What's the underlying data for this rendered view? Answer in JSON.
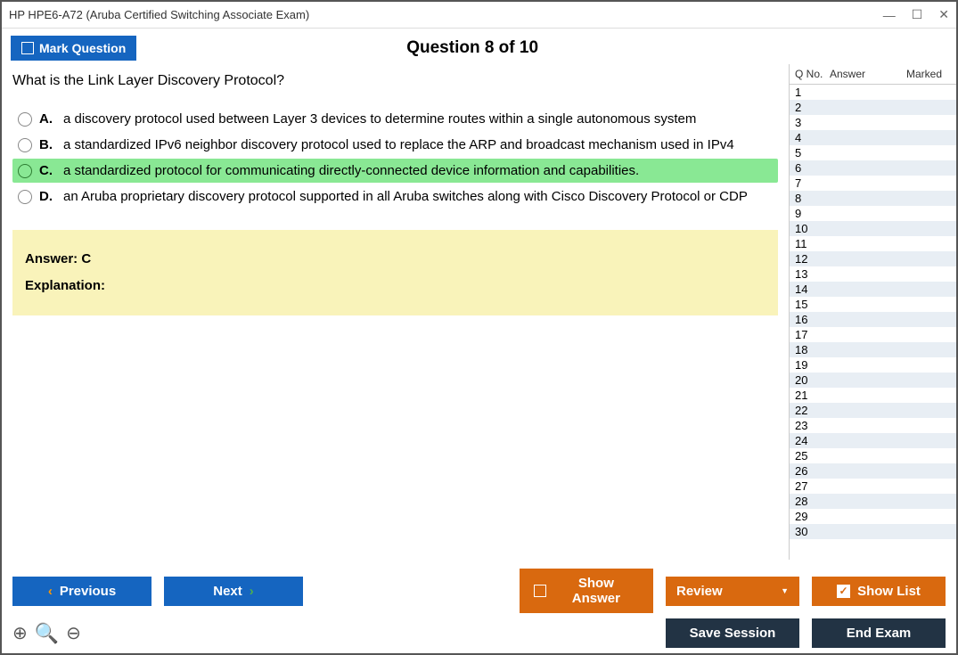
{
  "window": {
    "title": "HP HPE6-A72 (Aruba Certified Switching Associate Exam)"
  },
  "header": {
    "mark_label": "Mark Question",
    "question_counter": "Question 8 of 10"
  },
  "question": {
    "text": "What is the Link Layer Discovery Protocol?",
    "options": [
      {
        "letter": "A.",
        "text": "a discovery protocol used between Layer 3 devices to determine routes within a single autonomous system",
        "correct": false
      },
      {
        "letter": "B.",
        "text": "a standardized IPv6 neighbor discovery protocol used to replace the ARP and broadcast mechanism used in IPv4",
        "correct": false
      },
      {
        "letter": "C.",
        "text": "a standardized protocol for communicating directly-connected device information and capabilities.",
        "correct": true
      },
      {
        "letter": "D.",
        "text": "an Aruba proprietary discovery protocol supported in all Aruba switches along with Cisco Discovery Protocol or CDP",
        "correct": false
      }
    ],
    "answer_label": "Answer: C",
    "explanation_label": "Explanation:"
  },
  "list": {
    "col_qno": "Q No.",
    "col_answer": "Answer",
    "col_marked": "Marked",
    "rows": [
      "1",
      "2",
      "3",
      "4",
      "5",
      "6",
      "7",
      "8",
      "9",
      "10",
      "11",
      "12",
      "13",
      "14",
      "15",
      "16",
      "17",
      "18",
      "19",
      "20",
      "21",
      "22",
      "23",
      "24",
      "25",
      "26",
      "27",
      "28",
      "29",
      "30"
    ]
  },
  "buttons": {
    "previous": "Previous",
    "next": "Next",
    "show_answer": "Show Answer",
    "review": "Review",
    "show_list": "Show List",
    "save_session": "Save Session",
    "end_exam": "End Exam"
  }
}
